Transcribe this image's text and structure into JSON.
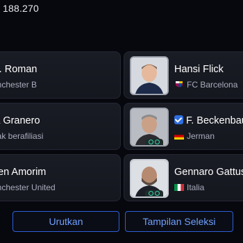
{
  "header": {
    "value": "188.270"
  },
  "cards": [
    {
      "name": "A. Roman",
      "sub": "anchester B"
    },
    {
      "name": "ia Granero",
      "sub": "dak berafiliasi"
    },
    {
      "name": "ben Amorim",
      "sub": "anchester United"
    },
    {
      "name": "Hansi Flick",
      "sub": "FC Barcelona",
      "flag": "fc-barcelona-crest-icon"
    },
    {
      "name": "F. Beckenbau",
      "sub": "Jerman",
      "flag": "germany-flag-icon",
      "verified": true
    },
    {
      "name": "Gennaro Gattus",
      "sub": "Italia",
      "flag": "italy-flag-icon"
    }
  ],
  "buttons": {
    "sort": "Urutkan",
    "view": "Tampilan Seleksi"
  },
  "colors": {
    "accent": "#2d5fd8",
    "button_text": "#6fa0ff",
    "badge": "#3fd1b0"
  }
}
